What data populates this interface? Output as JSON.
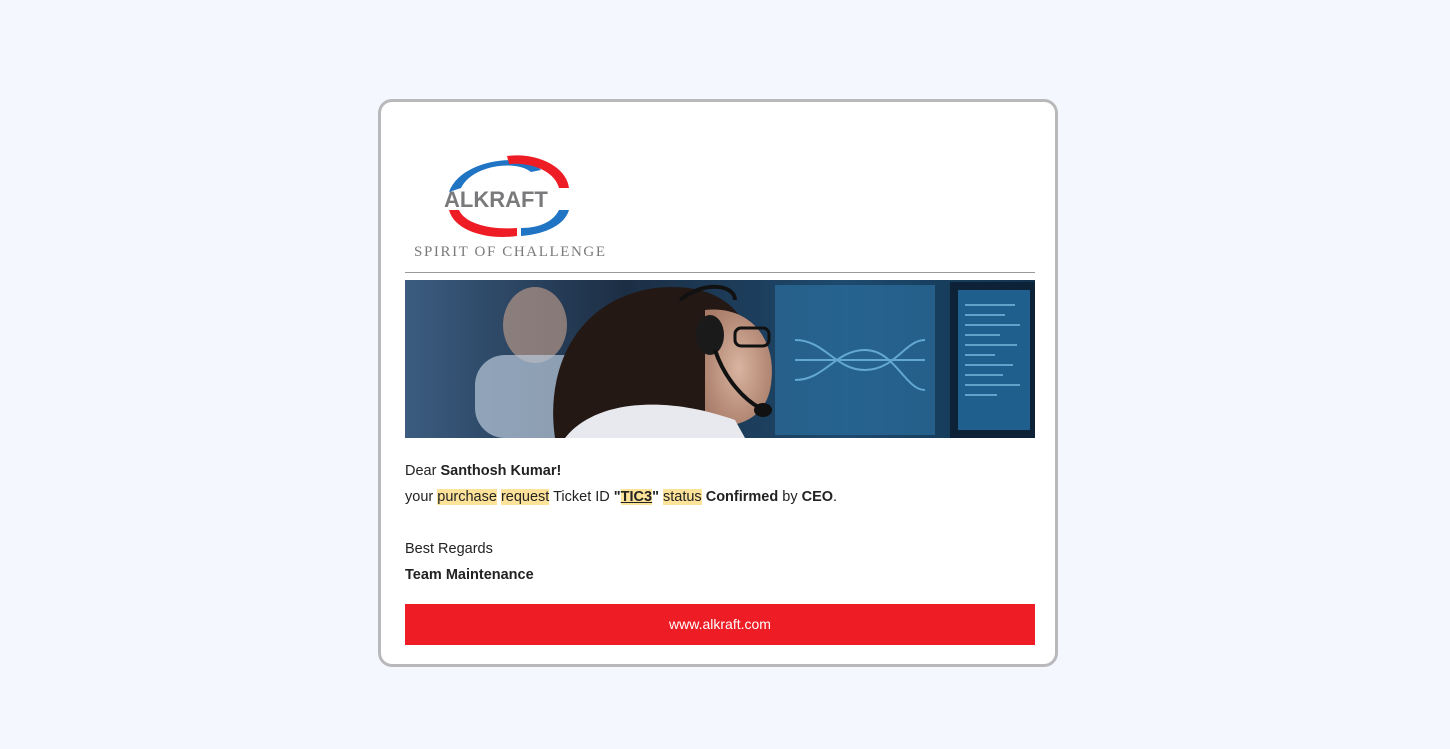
{
  "brand": {
    "name": "ALKRAFT",
    "tagline": "SPIRIT OF CHALLENGE",
    "colors": {
      "red": "#ee1c25",
      "blue": "#1f74c4",
      "gray": "#7a7a7c"
    }
  },
  "hero_image": {
    "alt": "Support agents with headsets at monitoring screens"
  },
  "email": {
    "greeting": "Dear",
    "recipient_name": "Santhosh Kumar!",
    "message": {
      "prefix": "your",
      "word_purchase": "purchase",
      "word_request": "request",
      "ticket_label": "Ticket ID",
      "quote_open": "\"",
      "ticket_id": "TIC3",
      "quote_close": "\"",
      "word_status": "status",
      "status_value": "Confirmed",
      "by_text": "by",
      "approver": "CEO",
      "end_punct": "."
    },
    "closing": "Best Regards",
    "signature": "Team Maintenance"
  },
  "footer": {
    "link_text": "www.alkraft.com"
  }
}
